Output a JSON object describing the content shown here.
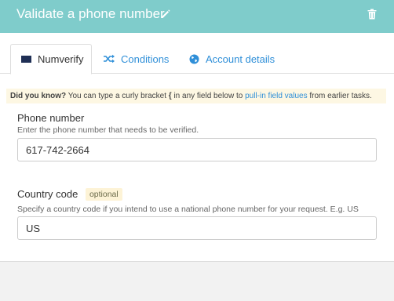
{
  "header": {
    "title": "Validate a phone number",
    "edit_icon": "pencil-icon",
    "delete_icon": "trash-icon",
    "bg_color": "#7fcccb"
  },
  "tabs": [
    {
      "label": "Numverify",
      "icon": "numverify-logo",
      "active": true
    },
    {
      "label": "Conditions",
      "icon": "shuffle-icon",
      "active": false
    },
    {
      "label": "Account details",
      "icon": "globe-icon",
      "active": false
    }
  ],
  "tip": {
    "lead": "Did you know?",
    "text_before": "You can type a curly bracket",
    "brace": "{",
    "text_middle": "in any field below to",
    "link": "pull-in field values",
    "text_after": "from earlier tasks."
  },
  "fields": {
    "phone": {
      "label": "Phone number",
      "help": "Enter the phone number that needs to be verified.",
      "value": "617-742-2664"
    },
    "country": {
      "label": "Country code",
      "badge": "optional",
      "help": "Specify a country code if you intend to use a national phone number for your request. E.g. US",
      "value": "US"
    }
  },
  "colors": {
    "link": "#2f8fd8",
    "tip_bg": "#fdf7e3"
  }
}
